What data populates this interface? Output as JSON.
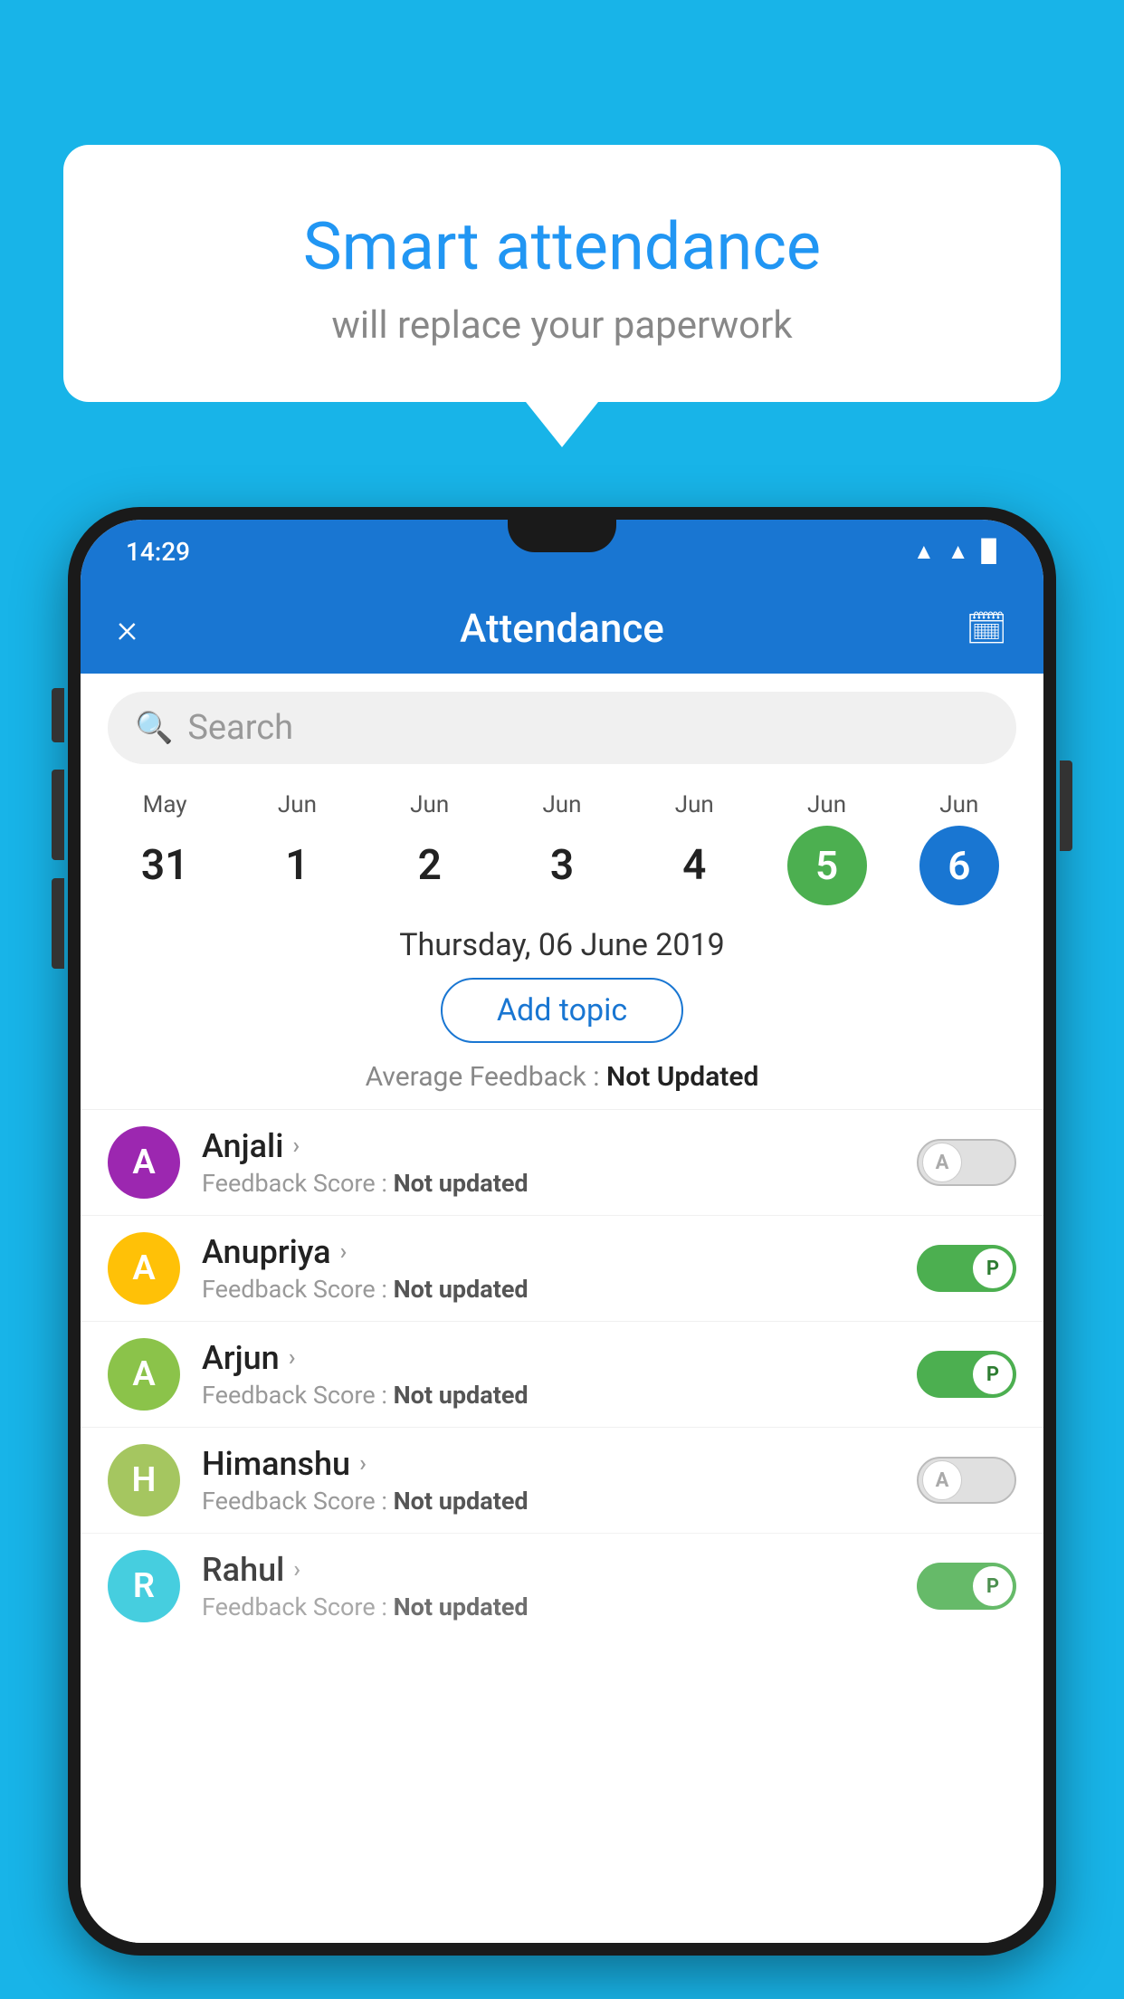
{
  "background_color": "#18b4e8",
  "speech_bubble": {
    "title": "Smart attendance",
    "subtitle": "will replace your paperwork"
  },
  "status_bar": {
    "time": "14:29",
    "icons": [
      "wifi",
      "signal",
      "battery"
    ]
  },
  "app_bar": {
    "title": "Attendance",
    "close_label": "×",
    "calendar_icon": "📅"
  },
  "search": {
    "placeholder": "Search"
  },
  "calendar": {
    "columns": [
      {
        "month": "May",
        "day": "31",
        "style": "normal"
      },
      {
        "month": "Jun",
        "day": "1",
        "style": "normal"
      },
      {
        "month": "Jun",
        "day": "2",
        "style": "normal"
      },
      {
        "month": "Jun",
        "day": "3",
        "style": "normal"
      },
      {
        "month": "Jun",
        "day": "4",
        "style": "normal"
      },
      {
        "month": "Jun",
        "day": "5",
        "style": "today"
      },
      {
        "month": "Jun",
        "day": "6",
        "style": "selected"
      }
    ]
  },
  "selected_date": "Thursday, 06 June 2019",
  "add_topic_label": "Add topic",
  "avg_feedback_label": "Average Feedback : ",
  "avg_feedback_value": "Not Updated",
  "students": [
    {
      "name": "Anjali",
      "initial": "A",
      "avatar_color": "#9c27b0",
      "feedback_label": "Feedback Score : ",
      "feedback_value": "Not updated",
      "toggle": "off"
    },
    {
      "name": "Anupriya",
      "initial": "A",
      "avatar_color": "#ffc107",
      "feedback_label": "Feedback Score : ",
      "feedback_value": "Not updated",
      "toggle": "on"
    },
    {
      "name": "Arjun",
      "initial": "A",
      "avatar_color": "#8bc34a",
      "feedback_label": "Feedback Score : ",
      "feedback_value": "Not updated",
      "toggle": "on"
    },
    {
      "name": "Himanshu",
      "initial": "H",
      "avatar_color": "#a5c660",
      "feedback_label": "Feedback Score : ",
      "feedback_value": "Not updated",
      "toggle": "off"
    },
    {
      "name": "Rahul",
      "initial": "R",
      "avatar_color": "#26c6da",
      "feedback_label": "Feedback Score : ",
      "feedback_value": "Not updated",
      "toggle": "on"
    }
  ],
  "toggle_labels": {
    "on": "P",
    "off": "A"
  }
}
